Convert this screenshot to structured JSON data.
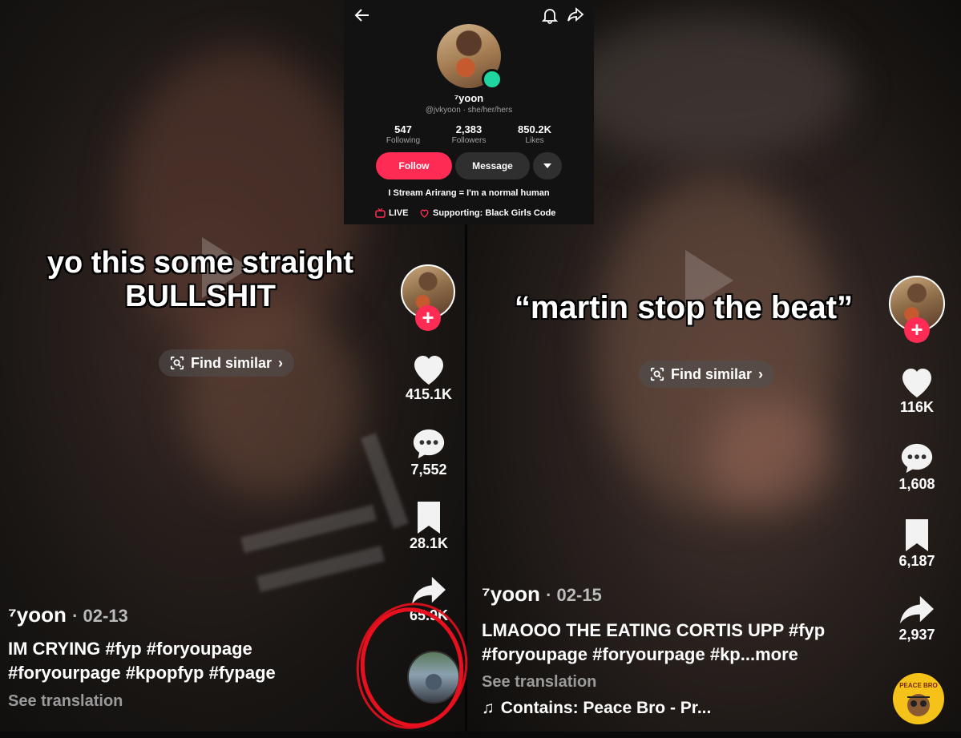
{
  "left_video": {
    "caption_line1": "yo this some straight",
    "caption_line2": "BULLSHIT",
    "find_similar": "Find similar",
    "likes": "415.1K",
    "comments": "7,552",
    "saves": "28.1K",
    "shares": "65.9K",
    "username": "⁷yoon",
    "date": "· 02-13",
    "desc_line1": "IM CRYING #fyp #foryoupage",
    "desc_line2": "#foryourpage #kpopfyp #fypage",
    "see_translation": "See translation"
  },
  "right_video": {
    "caption": "“martin stop the beat”",
    "find_similar": "Find similar",
    "likes": "116K",
    "comments": "1,608",
    "saves": "6,187",
    "shares": "2,937",
    "username": "⁷yoon",
    "date": "· 02-15",
    "desc_line1": "LMAOOO THE EATING CORTIS UPP #fyp",
    "desc_line2": "#foryoupage #foryourpage #kp...more",
    "see_translation": "See translation",
    "music": "Contains: Peace Bro - Pr...",
    "disc_label": "PEACE BRO"
  },
  "profile": {
    "name": "⁷yoon",
    "handle": "@jvkyoon · she/her/hers",
    "following_count": "547",
    "following_label": "Following",
    "followers_count": "2,383",
    "followers_label": "Followers",
    "likes_count": "850.2K",
    "likes_label": "Likes",
    "follow_button": "Follow",
    "message_button": "Message",
    "bio": "I Stream Arirang = I'm a normal human",
    "live_label": "LIVE",
    "supporting": "Supporting: Black Girls Code"
  },
  "colors": {
    "accent": "#fe2c55",
    "annotation_red": "#e8101e",
    "online": "#20d5a0"
  }
}
